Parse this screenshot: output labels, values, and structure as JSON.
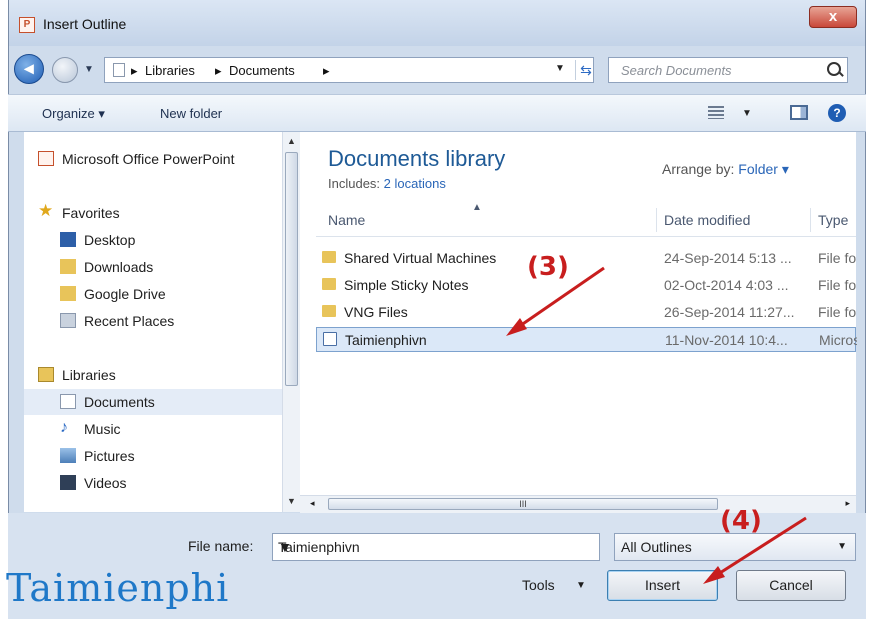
{
  "window": {
    "title": "Insert Outline",
    "close": "x"
  },
  "address": {
    "segments": [
      "Libraries",
      "Documents"
    ]
  },
  "search": {
    "placeholder": "Search Documents"
  },
  "toolbar": {
    "organize": "Organize ▾",
    "new_folder": "New folder"
  },
  "nav": {
    "top_item": "Microsoft Office PowerPoint",
    "favorites": "Favorites",
    "favorites_items": [
      "Desktop",
      "Downloads",
      "Google Drive",
      "Recent Places"
    ],
    "libraries": "Libraries",
    "libraries_items": [
      "Documents",
      "Music",
      "Pictures",
      "Videos"
    ]
  },
  "library": {
    "title": "Documents library",
    "includes_label": "Includes:",
    "includes_link": "2 locations",
    "arrange_label": "Arrange by:",
    "arrange_value": "Folder ▾"
  },
  "columns": {
    "name": "Name",
    "date": "Date modified",
    "type": "Type"
  },
  "files": [
    {
      "name": "Shared Virtual Machines",
      "date": "24-Sep-2014 5:13 ...",
      "type": "File folder",
      "kind": "folder"
    },
    {
      "name": "Simple Sticky Notes",
      "date": "02-Oct-2014 4:03 ...",
      "type": "File folder",
      "kind": "folder"
    },
    {
      "name": "VNG Files",
      "date": "26-Sep-2014 11:27...",
      "type": "File folder",
      "kind": "folder"
    },
    {
      "name": "Taimienphivn",
      "date": "11-Nov-2014 10:4...",
      "type": "Microsoft",
      "kind": "doc"
    }
  ],
  "bottom": {
    "file_name_label": "File name:",
    "file_name_value": "Taimienphivn",
    "filter": "All Outlines",
    "tools": "Tools",
    "insert": "Insert",
    "cancel": "Cancel"
  },
  "annotations": {
    "step3": "(3)",
    "step4": "(4)"
  },
  "watermark": "Taimienphi",
  "colors": {
    "annotation": "#c81e1e",
    "accent": "#1e5a96",
    "selection": "#dbe8f8"
  }
}
